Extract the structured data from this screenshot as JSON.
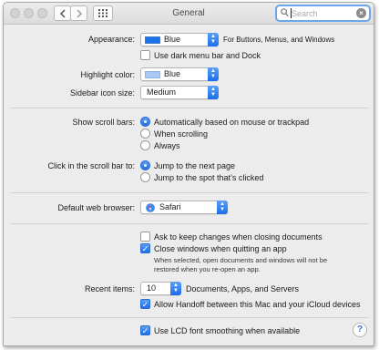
{
  "window": {
    "title": "General"
  },
  "search": {
    "placeholder": "Search",
    "value": ""
  },
  "appearance": {
    "label": "Appearance:",
    "value": "Blue",
    "hint": "For Buttons, Menus, and Windows",
    "dark_menu_label": "Use dark menu bar and Dock",
    "dark_menu_checked": false
  },
  "highlight": {
    "label": "Highlight color:",
    "value": "Blue"
  },
  "sidebar_icon": {
    "label": "Sidebar icon size:",
    "value": "Medium"
  },
  "scroll_bars": {
    "label": "Show scroll bars:",
    "options": [
      "Automatically based on mouse or trackpad",
      "When scrolling",
      "Always"
    ],
    "selected": 0
  },
  "scroll_click": {
    "label": "Click in the scroll bar to:",
    "options": [
      "Jump to the next page",
      "Jump to the spot that’s clicked"
    ],
    "selected": 0
  },
  "browser": {
    "label": "Default web browser:",
    "value": "Safari"
  },
  "documents": {
    "ask_label": "Ask to keep changes when closing documents",
    "ask_checked": false,
    "close_label": "Close windows when quitting an app",
    "close_checked": true,
    "note_line1": "When selected, open documents and windows will not be",
    "note_line2": "restored when you re-open an app."
  },
  "recent": {
    "label": "Recent items:",
    "value": "10",
    "suffix": "Documents, Apps, and Servers"
  },
  "handoff": {
    "label": "Allow Handoff between this Mac and your iCloud devices",
    "checked": true
  },
  "lcd": {
    "label": "Use LCD font smoothing when available",
    "checked": true
  },
  "help": {
    "glyph": "?"
  },
  "colors": {
    "accent": "#1e73e8",
    "swatch": "#1e73e8"
  },
  "icons": [
    "back-chevron-icon",
    "forward-chevron-icon",
    "show-all-grid-icon",
    "magnifier-icon",
    "clear-search-icon",
    "safari-compass-icon",
    "checkmark-icon",
    "help-icon"
  ]
}
